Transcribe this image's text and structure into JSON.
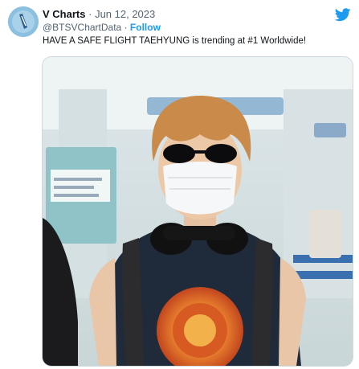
{
  "tweet": {
    "display_name": "V Charts",
    "separator": "·",
    "date": "Jun 12, 2023",
    "handle": "@BTSVChartData",
    "follow_label": "Follow",
    "text": "HAVE A SAFE FLIGHT TAEHYUNG is trending at #1 Worldwide!"
  },
  "icons": {
    "brand": "twitter-bird-icon",
    "avatar": "avatar-image"
  },
  "colors": {
    "accent": "#1d9bf0",
    "text": "#0f1419",
    "muted": "#536471"
  },
  "media": {
    "description_icon": "airport-photo-image"
  }
}
